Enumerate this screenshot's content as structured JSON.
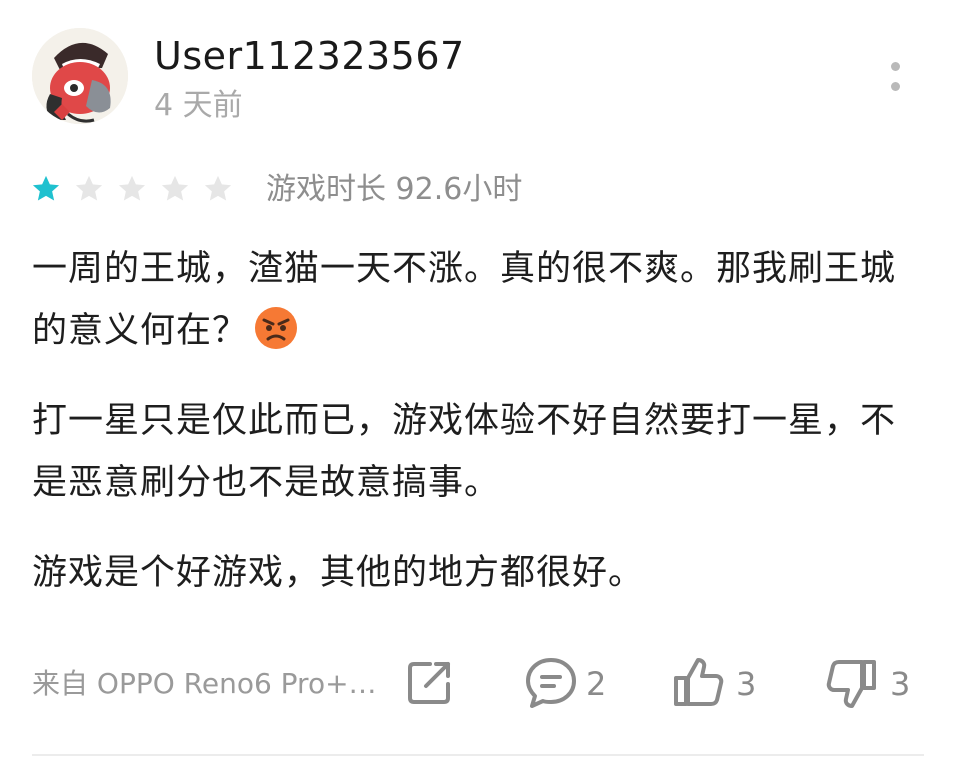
{
  "review": {
    "username": "User112323567",
    "time_ago": "4 天前",
    "rating": 1,
    "max_rating": 5,
    "playtime": "游戏时长 92.6小时",
    "paragraphs": {
      "p1": "一周的王城，渣猫一天不涨。真的很不爽。那我刷王城的意义何在？",
      "p2": "打一星只是仅此而已，游戏体验不好自然要打一星，不是恶意刷分也不是故意搞事。",
      "p3": "游戏是个好游戏，其他的地方都很好。"
    },
    "device": "来自 OPPO Reno6 Pro+…",
    "comment_count": "2",
    "like_count": "3",
    "dislike_count": "3"
  },
  "colors": {
    "star_filled": "#1fc1cf",
    "star_empty": "#e6e6e6",
    "icon_gray": "#8a8a8a",
    "emoji_face": "#f28a3a"
  },
  "icons": {
    "more": "more-vertical-icon",
    "share": "share-icon",
    "comment": "comment-icon",
    "like": "thumbs-up-icon",
    "dislike": "thumbs-down-icon",
    "star": "star-icon",
    "emoji": "angry-face-emoji"
  }
}
